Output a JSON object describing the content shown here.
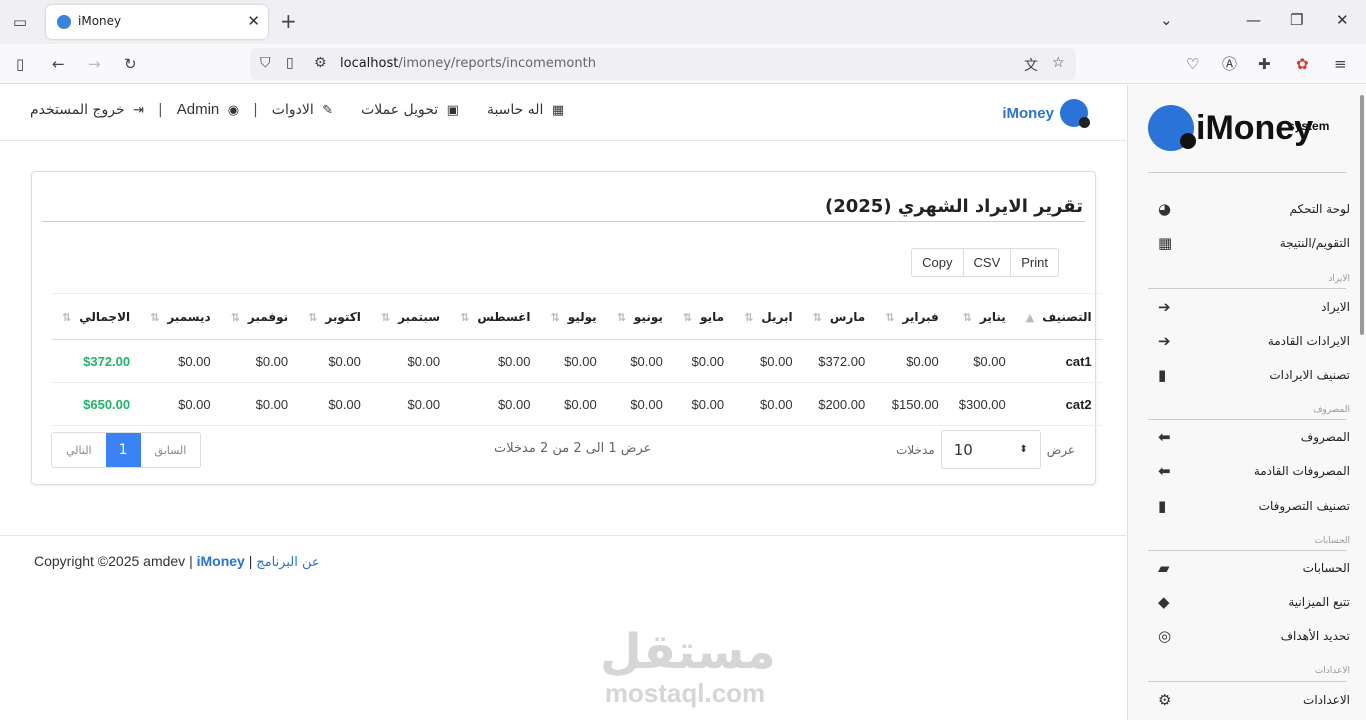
{
  "browser": {
    "tab_title": "iMoney",
    "url_host": "localhost",
    "url_path": "/imoney/reports/incomemonth"
  },
  "topbar": {
    "brand": "iMoney",
    "links": {
      "logout": "خروج المستخدم",
      "user": "Admin",
      "tools": "الادوات",
      "currency": "تحويل عملات",
      "calculator": "اله حاسبة"
    }
  },
  "report": {
    "title": "تقرير الايراد الشهري (2025)",
    "buttons": {
      "print": "Print",
      "csv": "CSV",
      "copy": "Copy"
    },
    "columns": [
      "التصنيف",
      "يناير",
      "فبراير",
      "مارس",
      "ابريل",
      "مايو",
      "يونيو",
      "يوليو",
      "اغسطس",
      "سبتمبر",
      "اكتوبر",
      "نوفمبر",
      "ديسمبر",
      "الاجمالي"
    ],
    "rows": [
      {
        "cells": [
          "cat1",
          "$0.00",
          "$0.00",
          "$372.00",
          "$0.00",
          "$0.00",
          "$0.00",
          "$0.00",
          "$0.00",
          "$0.00",
          "$0.00",
          "$0.00",
          "$0.00",
          "$372.00"
        ]
      },
      {
        "cells": [
          "cat2",
          "$300.00",
          "$150.00",
          "$200.00",
          "$0.00",
          "$0.00",
          "$0.00",
          "$0.00",
          "$0.00",
          "$0.00",
          "$0.00",
          "$0.00",
          "$0.00",
          "$650.00"
        ]
      }
    ],
    "length": {
      "show": "عرض",
      "value": "10",
      "entries": "مدخلات"
    },
    "info": "عرض 1 الى 2 من 2 مدخلات",
    "pager": {
      "prev": "السابق",
      "page": "1",
      "next": "التالي"
    }
  },
  "footer": {
    "copyright": "Copyright ©2025 amdev | ",
    "brand": "iMoney",
    "sep": " | ",
    "about": "عن البرنامج"
  },
  "watermark": {
    "arabic": "مستقل",
    "latin": "mostaql.com"
  },
  "sidebar": {
    "logo_text": "iMoney",
    "logo_sub": "system",
    "dashboard": "لوحة التحكم",
    "calendar": "التقويم/النتيجة",
    "income_group": "الايراد",
    "income": "الايراد",
    "upcoming_income": "الايرادات القادمة",
    "income_categories": "تصنيف الايرادات",
    "expense_group": "المصروف",
    "expense": "المصروف",
    "upcoming_expense": "المصروفات القادمة",
    "expense_categories": "تصنيف التصروفات",
    "accounts_group": "الحسابات",
    "accounts": "الحسابات",
    "budget": "تتبع الميزانية",
    "goals": "تحديد الأهداف",
    "settings_group": "الاعدادات",
    "settings": "الاعدادات"
  }
}
